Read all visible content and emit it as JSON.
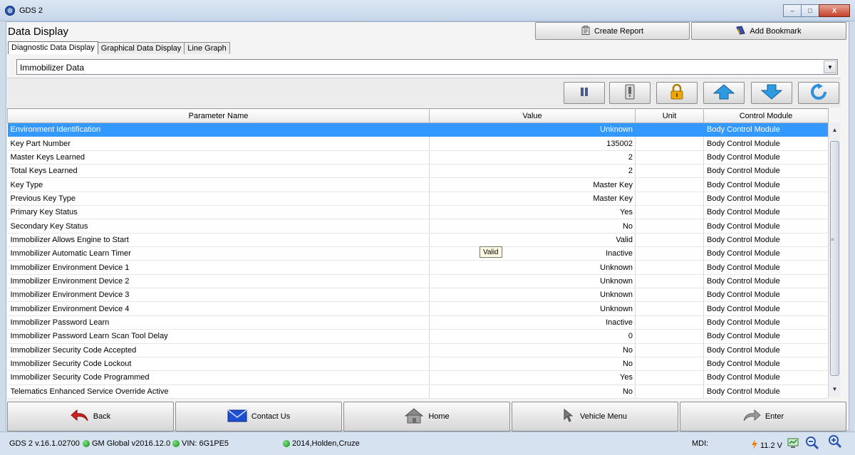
{
  "window": {
    "title": "GDS 2",
    "buttons": {
      "minimize": "–",
      "maximize": "□",
      "close": "X"
    }
  },
  "header": {
    "title": "Data Display",
    "create_report": "Create Report",
    "add_bookmark": "Add Bookmark"
  },
  "tabs": [
    {
      "label": "Diagnostic Data Display",
      "active": true
    },
    {
      "label": "Graphical Data Display",
      "active": false
    },
    {
      "label": "Line Graph",
      "active": false
    }
  ],
  "combo": {
    "selected": "Immobilizer Data"
  },
  "toolbar": {
    "icons": [
      "pause-icon",
      "usb-connector-icon",
      "lock-icon",
      "arrow-up-icon",
      "arrow-down-icon",
      "refresh-icon"
    ]
  },
  "table": {
    "headers": {
      "param": "Parameter Name",
      "value": "Value",
      "unit": "Unit",
      "module": "Control Module"
    },
    "rows": [
      {
        "param": "Environment Identification",
        "value": "Unknown",
        "unit": "",
        "module": "Body Control Module",
        "selected": true
      },
      {
        "param": "Key Part Number",
        "value": "135002",
        "unit": "",
        "module": "Body Control Module"
      },
      {
        "param": "Master Keys Learned",
        "value": "2",
        "unit": "",
        "module": "Body Control Module"
      },
      {
        "param": "Total Keys Learned",
        "value": "2",
        "unit": "",
        "module": "Body Control Module"
      },
      {
        "param": "Key Type",
        "value": "Master Key",
        "unit": "",
        "module": "Body Control Module"
      },
      {
        "param": "Previous Key Type",
        "value": "Master Key",
        "unit": "",
        "module": "Body Control Module"
      },
      {
        "param": "Primary Key Status",
        "value": "Yes",
        "unit": "",
        "module": "Body Control Module"
      },
      {
        "param": "Secondary Key Status",
        "value": "No",
        "unit": "",
        "module": "Body Control Module"
      },
      {
        "param": "Immobilizer Allows Engine to Start",
        "value": "Valid",
        "unit": "",
        "module": "Body Control Module"
      },
      {
        "param": "Immobilizer Automatic Learn Timer",
        "value": "Inactive",
        "unit": "",
        "module": "Body Control Module"
      },
      {
        "param": "Immobilizer Environment Device 1",
        "value": "Unknown",
        "unit": "",
        "module": "Body Control Module"
      },
      {
        "param": "Immobilizer Environment Device 2",
        "value": "Unknown",
        "unit": "",
        "module": "Body Control Module"
      },
      {
        "param": "Immobilizer Environment Device 3",
        "value": "Unknown",
        "unit": "",
        "module": "Body Control Module"
      },
      {
        "param": "Immobilizer Environment Device 4",
        "value": "Unknown",
        "unit": "",
        "module": "Body Control Module"
      },
      {
        "param": "Immobilizer Password Learn",
        "value": "Inactive",
        "unit": "",
        "module": "Body Control Module"
      },
      {
        "param": "Immobilizer Password Learn Scan Tool Delay",
        "value": "0",
        "unit": "",
        "module": "Body Control Module"
      },
      {
        "param": "Immobilizer Security Code Accepted",
        "value": "No",
        "unit": "",
        "module": "Body Control Module"
      },
      {
        "param": "Immobilizer Security Code Lockout",
        "value": "No",
        "unit": "",
        "module": "Body Control Module"
      },
      {
        "param": "Immobilizer Security Code Programmed",
        "value": "Yes",
        "unit": "",
        "module": "Body Control Module"
      },
      {
        "param": "Telematics Enhanced Service Override Active",
        "value": "No",
        "unit": "",
        "module": "Body Control Module"
      }
    ]
  },
  "tooltip": "Valid",
  "nav": {
    "back": "Back",
    "contact": "Contact Us",
    "home": "Home",
    "vehicle_menu": "Vehicle Menu",
    "enter": "Enter"
  },
  "status": {
    "version": "GDS 2 v.16.1.02700",
    "global": "GM Global v2016.12.0",
    "vin": "VIN: 6G1PE5",
    "vehicle": "2014,Holden,Cruze",
    "mdi": "MDI:",
    "voltage": "11.2 V"
  },
  "colors": {
    "selected_row": "#3399ff",
    "status_ok": "#128a12",
    "back_arrow": "#cc2222",
    "nav_arrow": "#2a8ad8"
  }
}
